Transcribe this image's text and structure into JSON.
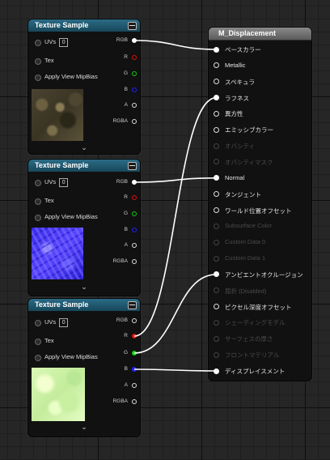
{
  "texture_nodes": [
    {
      "title": "Texture Sample",
      "inputs": {
        "uvs": "UVs",
        "uvs_value": "0",
        "tex": "Tex",
        "mip": "Apply View MipBias"
      },
      "outputs": [
        "RGB",
        "R",
        "G",
        "B",
        "A",
        "RGBA"
      ],
      "preview": "dirt-texture-preview"
    },
    {
      "title": "Texture Sample",
      "inputs": {
        "uvs": "UVs",
        "uvs_value": "0",
        "tex": "Tex",
        "mip": "Apply View MipBias"
      },
      "outputs": [
        "RGB",
        "R",
        "G",
        "B",
        "A",
        "RGBA"
      ],
      "preview": "normal-map-preview"
    },
    {
      "title": "Texture Sample",
      "inputs": {
        "uvs": "UVs",
        "uvs_value": "0",
        "tex": "Tex",
        "mip": "Apply View MipBias"
      },
      "outputs": [
        "RGB",
        "R",
        "G",
        "B",
        "A",
        "RGBA"
      ],
      "preview": "mask-texture-preview"
    }
  ],
  "material": {
    "title": "M_Displacement",
    "inputs": [
      {
        "label": "ベースカラー",
        "enabled": true,
        "connected": true
      },
      {
        "label": "Metallic",
        "enabled": true,
        "connected": false
      },
      {
        "label": "スペキュラ",
        "enabled": true,
        "connected": false
      },
      {
        "label": "ラフネス",
        "enabled": true,
        "connected": true
      },
      {
        "label": "異方性",
        "enabled": true,
        "connected": false
      },
      {
        "label": "エミッシブカラー",
        "enabled": true,
        "connected": false
      },
      {
        "label": "オパシティ",
        "enabled": false,
        "connected": false
      },
      {
        "label": "オパシティマスク",
        "enabled": false,
        "connected": false
      },
      {
        "label": "Normal",
        "enabled": true,
        "connected": true
      },
      {
        "label": "タンジェント",
        "enabled": true,
        "connected": false
      },
      {
        "label": "ワールド位置オフセット",
        "enabled": true,
        "connected": false
      },
      {
        "label": "Subsurface Color",
        "enabled": false,
        "connected": false
      },
      {
        "label": "Custom Data 0",
        "enabled": false,
        "connected": false
      },
      {
        "label": "Custom Data 1",
        "enabled": false,
        "connected": false
      },
      {
        "label": "アンビエントオクルージョン",
        "enabled": true,
        "connected": true
      },
      {
        "label": "屈折 (Disabled)",
        "enabled": false,
        "connected": false
      },
      {
        "label": "ピクセル深度オフセット",
        "enabled": true,
        "connected": false
      },
      {
        "label": "シェーディングモデル",
        "enabled": false,
        "connected": false
      },
      {
        "label": "サーフェスの厚さ",
        "enabled": false,
        "connected": false
      },
      {
        "label": "フロントマテリアル",
        "enabled": false,
        "connected": false
      },
      {
        "label": "ディスプレイスメント",
        "enabled": true,
        "connected": true
      }
    ]
  },
  "connections": [
    {
      "from": "texture_nodes.0.RGB",
      "to": "ベースカラー",
      "color": "#ffffff"
    },
    {
      "from": "texture_nodes.1.RGB",
      "to": "Normal",
      "color": "#ffffff"
    },
    {
      "from": "texture_nodes.2.R",
      "to": "ラフネス",
      "color": "#ffffff"
    },
    {
      "from": "texture_nodes.2.G",
      "to": "アンビエントオクルージョン",
      "color": "#ffffff"
    },
    {
      "from": "texture_nodes.2.B",
      "to": "ディスプレイスメント",
      "color": "#ffffff"
    }
  ],
  "colors": {
    "pin_r": "#dd1111",
    "pin_g": "#11dd11",
    "pin_b": "#2222ff",
    "texture_header": "#1e5a73",
    "material_header": "#6e6e6e"
  }
}
